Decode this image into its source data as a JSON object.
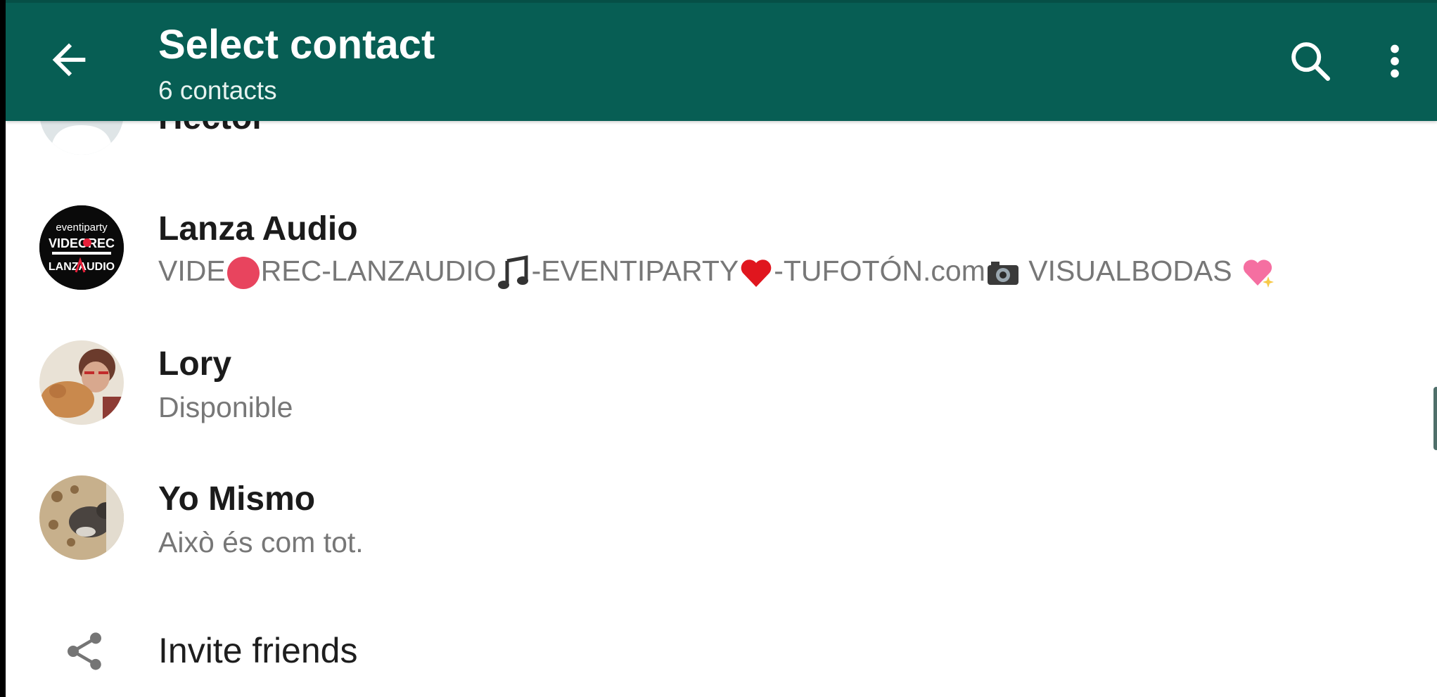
{
  "header": {
    "title": "Select contact",
    "subtitle": "6 contacts",
    "back_icon": "arrow-left-icon",
    "search_icon": "search-icon",
    "menu_icon": "more-vert-icon"
  },
  "contacts": [
    {
      "name": "Hector",
      "status": ""
    },
    {
      "name": "Lanza Audio",
      "status_parts": [
        "VIDE",
        "REC-LANZAUDIO",
        "-EVENTIPARTY",
        "-TUFOTÓN.com",
        " VISUALBODAS "
      ]
    },
    {
      "name": "Lory",
      "status": "Disponible"
    },
    {
      "name": "Yo Mismo",
      "status": "Això és com tot."
    }
  ],
  "invite": {
    "label": "Invite friends",
    "icon": "share-icon"
  },
  "colors": {
    "appbar": "#075e54",
    "name": "#1b1b1b",
    "status": "#777777",
    "icon_grey": "#757575"
  }
}
